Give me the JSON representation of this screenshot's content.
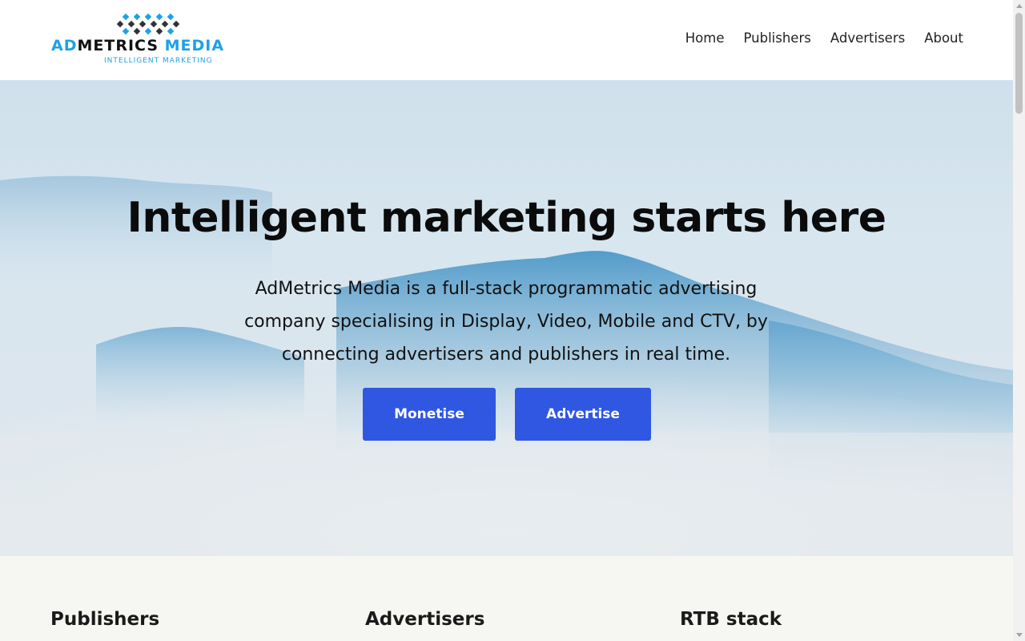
{
  "header": {
    "logo": {
      "part1": "AD",
      "part2": "METRICS",
      "part3": "MEDIA",
      "tagline": "INTELLIGENT MARKETING",
      "icon": "diamond-grid-logo-mark"
    },
    "nav": [
      {
        "label": "Home"
      },
      {
        "label": "Publishers"
      },
      {
        "label": "Advertisers"
      },
      {
        "label": "About"
      }
    ]
  },
  "hero": {
    "title": "Intelligent marketing starts here",
    "description": "AdMetrics Media is a full-stack programmatic advertising company specialising in Display, Video, Mobile and CTV, by connecting advertisers and publishers in real time.",
    "buttons": [
      {
        "label": "Monetise"
      },
      {
        "label": "Advertise"
      }
    ],
    "background": "misty-blue-mountains"
  },
  "features": [
    {
      "title": "Publishers"
    },
    {
      "title": "Advertisers"
    },
    {
      "title": "RTB stack"
    }
  ],
  "colors": {
    "accent": "#1da1e6",
    "button": "#3057e1",
    "features_bg": "#f6f6f2"
  }
}
